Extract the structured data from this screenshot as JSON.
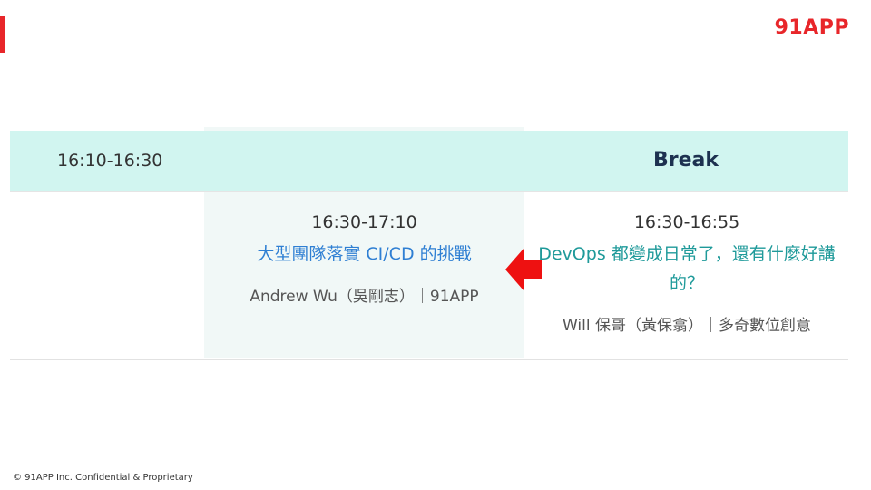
{
  "logo": {
    "text": "91APP",
    "color": "#e8262a"
  },
  "accent_color": "#e8262a",
  "break_row": {
    "time": "16:10-16:30",
    "label": "Break",
    "background": "#d1f5f0"
  },
  "sessions": [
    {
      "time": "16:30-17:10",
      "title": "大型團隊落實 CI/CD 的挑戰",
      "speaker": "Andrew Wu（吳剛志）｜91APP",
      "title_color": "#2f7fd3"
    },
    {
      "time": "16:30-16:55",
      "title": "DevOps 都變成日常了，還有什麼好講的？",
      "speaker": "Will 保哥（黃保翕）｜多奇數位創意",
      "title_color": "#1f9a9a"
    }
  ],
  "highlight_arrow": {
    "icon": "left-arrow-icon",
    "color": "#ee1111"
  },
  "footer": {
    "text": "© 91APP Inc. Confidential & Proprietary"
  }
}
